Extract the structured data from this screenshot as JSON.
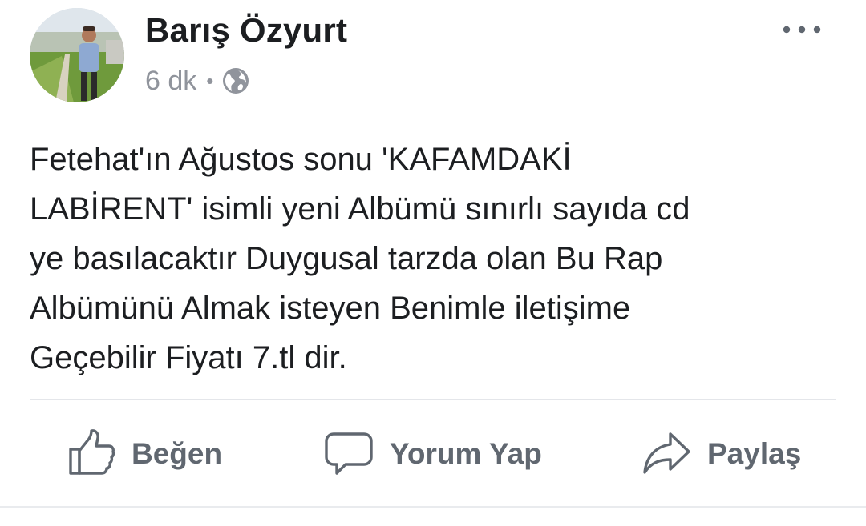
{
  "post": {
    "author": {
      "name": "Barış Özyurt",
      "avatar_icon": "profile-photo"
    },
    "time": "6 dk",
    "separator": "•",
    "privacy_icon": "globe-icon",
    "more_icon": "more-options-icon",
    "text": "Fetehat'ın Ağustos sonu 'KAFAMDAKİ\nLABİRENT' isimli yeni Albümü sınırlı sayıda cd\nye basılacaktır Duygusal tarzda olan Bu Rap\nAlbümünü Almak isteyen Benimle iletişime\nGeçebilir Fiyatı 7.tl dir."
  },
  "actions": {
    "like": {
      "label": "Beğen",
      "icon": "thumbs-up-icon"
    },
    "comment": {
      "label": "Yorum Yap",
      "icon": "comment-icon"
    },
    "share": {
      "label": "Paylaş",
      "icon": "share-icon"
    }
  },
  "colors": {
    "text_primary": "#1c1e21",
    "text_secondary": "#90949c",
    "action_gray": "#606770",
    "divider": "#e4e6ea"
  }
}
